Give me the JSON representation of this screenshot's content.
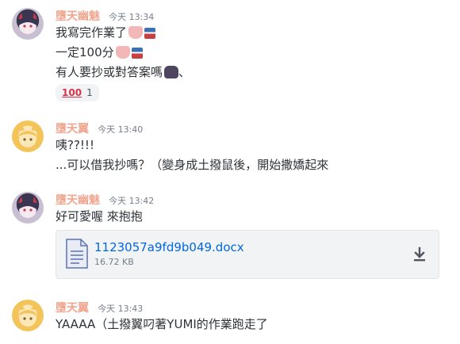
{
  "messages": [
    {
      "username": "墮天幽魅",
      "time": "今天 13:34",
      "lines": [
        "我寫完作業了",
        "一定100分",
        "有人要抄或對答案嗎"
      ],
      "line3_suffix": "、",
      "reaction": {
        "emoji": "100",
        "count": "1"
      }
    },
    {
      "username": "墮天翼",
      "time": "今天 13:40",
      "lines": [
        "咦??!!!",
        "...可以借我抄嗎？（變身成土撥鼠後，開始撒嬌起來"
      ]
    },
    {
      "username": "墮天幽魅",
      "time": "今天 13:42",
      "lines": [
        "好可愛喔 來抱抱"
      ],
      "attachment": {
        "file_name": "1123057a9fd9b049.docx",
        "file_size": "16.72 KB"
      }
    },
    {
      "username": "墮天翼",
      "time": "今天 13:43",
      "lines": [
        "YAAAA（土撥翼叼著YUMI的作業跑走了"
      ]
    }
  ],
  "colors": {
    "username": "#f0a58e",
    "link": "#0068e0",
    "text": "#2e3338",
    "timestamp": "#747f8d"
  },
  "icons": [
    "heart-emoji-icon",
    "flag-emoji-icon",
    "cat-emoji-icon",
    "hundred-points-icon",
    "document-file-icon",
    "download-icon"
  ]
}
